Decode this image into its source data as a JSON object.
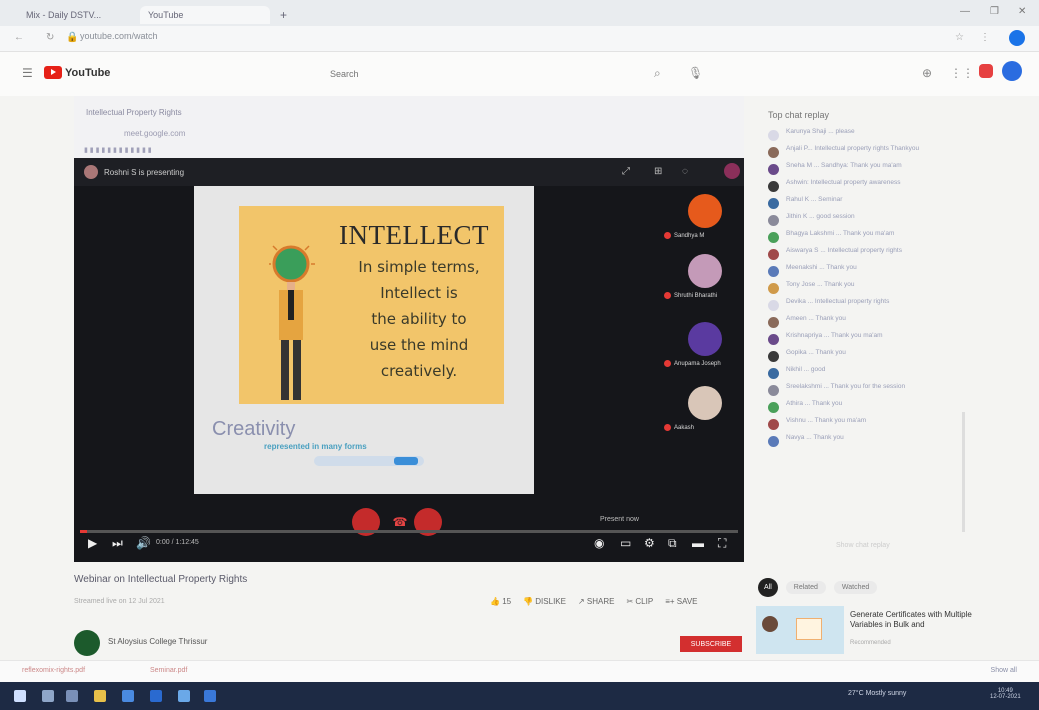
{
  "browser": {
    "tabs": [
      "Mix - Daily DSTV...",
      "YouTube"
    ],
    "address": "youtube.com/watch",
    "new_tab": "+"
  },
  "youtube": {
    "logo": "YouTube",
    "search_placeholder": "Search"
  },
  "video": {
    "presenter": "Roshni S is presenting",
    "inner_tabs": "Intellectual Property Rights",
    "inner_address": "meet.google.com",
    "slide": {
      "title": "INTELLECT",
      "lines": [
        "In simple terms,",
        "Intellect is",
        "the ability to",
        "use the mind",
        "creatively."
      ],
      "subtitle": "Creativity",
      "sub_caption": "represented in many forms"
    },
    "participants": [
      "Sandhya M",
      "Shruthi Bharathi",
      "Anupama Joseph",
      "Aakash"
    ],
    "controls": {
      "present_now": "Present now",
      "time": "0:00 / 1:12:45"
    },
    "progress": 0.01
  },
  "below": {
    "title": "Webinar on Intellectual Property Rights",
    "meta": "Streamed live on 12 Jul 2021",
    "actions": [
      "15",
      "DISLIKE",
      "SHARE",
      "CLIP",
      "SAVE"
    ],
    "channel": "St Aloysius College Thrissur",
    "subscribe": "SUBSCRIBE"
  },
  "chat": {
    "header": "Top chat replay",
    "messages": [
      "Karunya Shaji ... please",
      "Anjali P... Intellectual property rights Thankyou",
      "Sneha M ... Sandhya: Thank you ma'am",
      "Ashwin: Intellectual property awareness",
      "Rahul K ... Seminar",
      "Jithin K ... good session",
      "Bhagya Lakshmi ... Thank you ma'am",
      "Aiswarya S ... Intellectual property rights",
      "Meenakshi ... Thank you",
      "Tony Jose ... Thank you",
      "Devika ... Intellectual property rights",
      "Ameen ... Thank you",
      "Krishnapriya ... Thank you ma'am",
      "Gopika ... Thank you",
      "Nikhil ... good",
      "Sreelakshmi ... Thank you for the session",
      "Athira ... Thank you",
      "Vishnu ... Thank you ma'am",
      "Navya ... Thank you"
    ],
    "more": "Show chat replay"
  },
  "recommended": {
    "chips": [
      "All",
      "Related",
      "Watched"
    ],
    "title": "Generate Certificates with Multiple Variables in Bulk and",
    "meta": "Recommended"
  },
  "downloads": {
    "items": [
      "reflexomix-rights.pdf",
      "Seminar.pdf"
    ],
    "show_all": "Show all"
  },
  "taskbar": {
    "weather": "27°C Mostly sunny",
    "time": "10:49",
    "date": "12-07-2021"
  },
  "colors": {
    "yt_red": "#e62117",
    "taskbar": "#1d2a44",
    "slide_bg": "#f2c56a"
  }
}
